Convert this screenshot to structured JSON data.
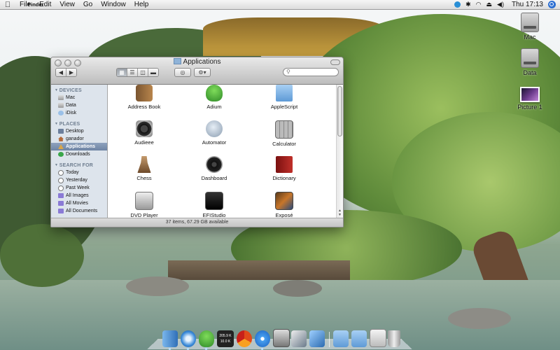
{
  "menubar": {
    "apple_icon": "apple-icon",
    "app_name": "Finder",
    "menus": [
      "File",
      "Edit",
      "View",
      "Go",
      "Window",
      "Help"
    ],
    "status_icons": [
      "skype-icon",
      "bluetooth-icon",
      "wifi-icon",
      "eject-icon",
      "volume-icon"
    ],
    "clock": "Thu 17:13",
    "spotlight_icon": "spotlight-icon"
  },
  "desktop_icons": [
    {
      "label": "Mac",
      "icon": "hard-drive-icon"
    },
    {
      "label": "Data",
      "icon": "hard-drive-icon"
    },
    {
      "label": "Picture 1",
      "icon": "picture-icon"
    }
  ],
  "window": {
    "title": "Applications",
    "search_placeholder": "",
    "view_buttons": [
      "icon-view",
      "list-view",
      "column-view",
      "coverflow-view"
    ],
    "active_view": "icon-view",
    "sidebar": {
      "sections": [
        {
          "heading": "DEVICES",
          "items": [
            {
              "label": "Mac",
              "icon": "hard-drive-icon"
            },
            {
              "label": "Data",
              "icon": "hard-drive-icon"
            },
            {
              "label": "iDisk",
              "icon": "idisk-icon"
            }
          ]
        },
        {
          "heading": "PLACES",
          "items": [
            {
              "label": "Desktop",
              "icon": "desktop-icon"
            },
            {
              "label": "ganador",
              "icon": "home-icon"
            },
            {
              "label": "Applications",
              "icon": "applications-icon",
              "selected": true
            },
            {
              "label": "Downloads",
              "icon": "downloads-icon"
            }
          ]
        },
        {
          "heading": "SEARCH FOR",
          "items": [
            {
              "label": "Today",
              "icon": "clock-icon"
            },
            {
              "label": "Yesterday",
              "icon": "clock-icon"
            },
            {
              "label": "Past Week",
              "icon": "clock-icon"
            },
            {
              "label": "All Images",
              "icon": "smart-folder-icon"
            },
            {
              "label": "All Movies",
              "icon": "smart-folder-icon"
            },
            {
              "label": "All Documents",
              "icon": "smart-folder-icon"
            }
          ]
        }
      ]
    },
    "apps": [
      {
        "label": "Address Book",
        "icon": "address-book-icon"
      },
      {
        "label": "Adium",
        "icon": "adium-icon"
      },
      {
        "label": "AppleScript",
        "icon": "folder-icon"
      },
      {
        "label": "Audieee",
        "icon": "audieee-icon"
      },
      {
        "label": "Automator",
        "icon": "automator-icon"
      },
      {
        "label": "Calculator",
        "icon": "calculator-icon"
      },
      {
        "label": "Chess",
        "icon": "chess-icon"
      },
      {
        "label": "Dashboard",
        "icon": "dashboard-icon"
      },
      {
        "label": "Dictionary",
        "icon": "dictionary-icon"
      },
      {
        "label": "DVD Player",
        "icon": "dvd-player-icon"
      },
      {
        "label": "EFIStudio",
        "icon": "efistudio-icon"
      },
      {
        "label": "Exposé",
        "icon": "expose-icon"
      }
    ],
    "status": "37 items, 67.29 GB available"
  },
  "dock": {
    "items": [
      {
        "name": "finder-dock-icon",
        "running": true
      },
      {
        "name": "safari-dock-icon",
        "running": true
      },
      {
        "name": "adium-dock-icon",
        "running": true
      },
      {
        "name": "istat-dock-icon",
        "running": false,
        "text_top": "205.9 K",
        "text_bottom": "10.0 K"
      },
      {
        "name": "crossover-dock-icon",
        "running": false
      },
      {
        "name": "itunes-dock-icon",
        "running": true
      },
      {
        "name": "photo-booth-dock-icon",
        "running": false
      },
      {
        "name": "utilities-dock-icon",
        "running": false
      },
      {
        "name": "preview-dock-icon",
        "running": false
      },
      {
        "name": "applications-stack-icon",
        "running": false
      },
      {
        "name": "documents-stack-icon",
        "running": false
      },
      {
        "name": "downloads-stack-icon",
        "running": false
      },
      {
        "name": "trash-dock-icon",
        "running": false
      }
    ]
  },
  "colors": {
    "sidebar_bg": "#dde4ec",
    "selection": "#7a8fad",
    "folder_blue": "#7fb0e0"
  }
}
